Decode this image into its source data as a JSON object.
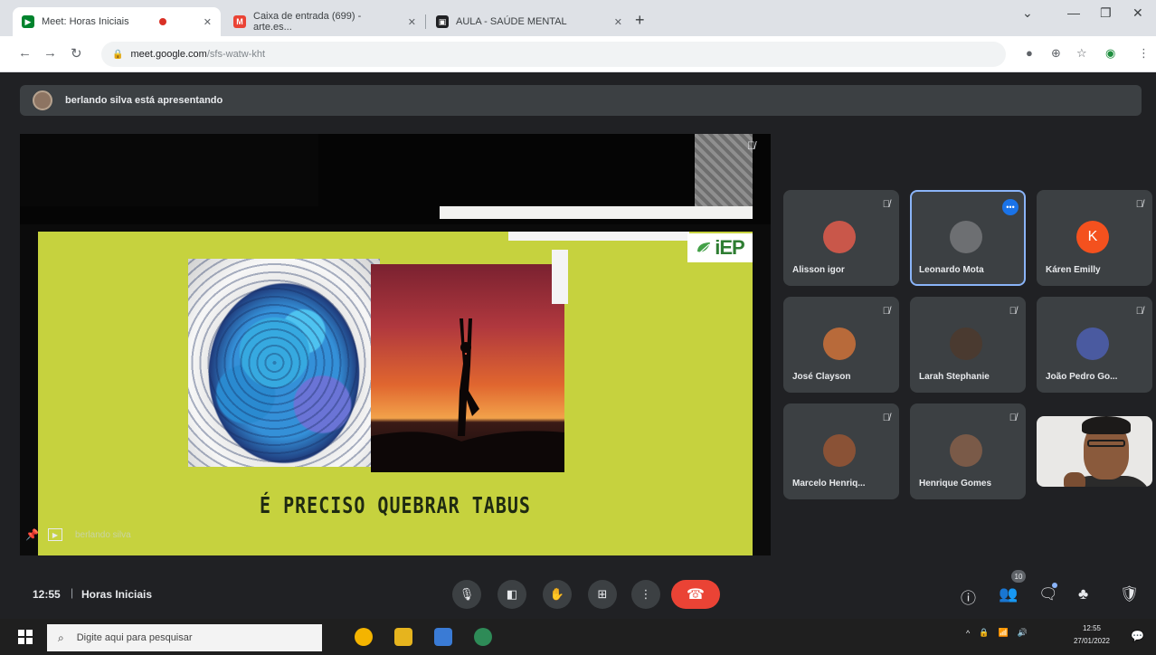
{
  "browser": {
    "tabs": [
      {
        "title": "Meet: Horas Iniciais",
        "active": true,
        "favicon_color": "#00832d"
      },
      {
        "title": "Caixa de entrada (699) - arte.es...",
        "active": false,
        "favicon_color": "#ea4335"
      },
      {
        "title": "AULA - SAÚDE MENTAL",
        "active": false,
        "favicon_color": "#202124"
      }
    ],
    "url_host": "meet.google.com",
    "url_path": "/sfs-watw-kht"
  },
  "presenter_banner": "berlando silva está apresentando",
  "slide": {
    "logo_text": "iEP",
    "caption": "É PRECISO QUEBRAR TABUS",
    "presenter_tag": "berlando silva"
  },
  "participants": [
    {
      "name": "Alisson igor",
      "avatar_color": "#c9574a"
    },
    {
      "name": "Leonardo Mota",
      "avatar_color": "#6d6f72",
      "speaking": true
    },
    {
      "name": "Káren Emilly",
      "avatar_letter": "K",
      "avatar_color": "#f4511e"
    },
    {
      "name": "José Clayson",
      "avatar_color": "#b86a3a"
    },
    {
      "name": "Larah Stephanie",
      "avatar_color": "#4a3a30"
    },
    {
      "name": "João Pedro Go...",
      "avatar_color": "#4a5aa0"
    },
    {
      "name": "Marcelo Henriq...",
      "avatar_color": "#8a5236"
    },
    {
      "name": "Henrique Gomes",
      "avatar_color": "#7a5a48"
    }
  ],
  "callbar": {
    "time": "12:55",
    "separator": "|",
    "meeting_name": "Horas Iniciais",
    "people_count": "10"
  },
  "taskbar": {
    "search_placeholder": "Digite aqui para pesquisar",
    "clock_time": "12:55",
    "clock_date": "27/01/2022"
  }
}
